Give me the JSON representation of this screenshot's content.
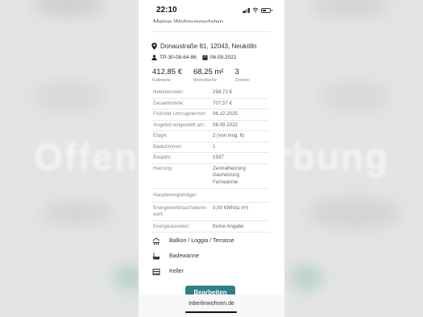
{
  "status_bar": {
    "time": "22:10"
  },
  "listing": {
    "section_title_cut": "Meine Wohnungsdaten",
    "address": "Donaustraße 81, 12043, Neukölln",
    "listing_id": "TP-30-08-64-86",
    "date": "06.09.2022",
    "kpis": [
      {
        "value": "412,85 €",
        "label": "Kaltmiete"
      },
      {
        "value": "68,25 m²",
        "label": "Wohnfläche"
      },
      {
        "value": "3",
        "label": "Zimmer"
      }
    ],
    "details": [
      {
        "label": "Nebenkosten:",
        "value": "294,72 €"
      },
      {
        "label": "Gesamtmiete:",
        "value": "707,57 €"
      },
      {
        "label": "Frühster Umzugstermin:",
        "value": "06.12.2025"
      },
      {
        "label": "Angebot eingestellt am:",
        "value": "06.09.2022"
      },
      {
        "label": "Etage:",
        "value": "2 (von insg. 6)"
      },
      {
        "label": "Badezimmer:",
        "value": "1"
      },
      {
        "label": "Baujahr:",
        "value": "1937"
      },
      {
        "label": "Heizung:",
        "value": "Zentralheizung\nGasheizung\nFernwärme"
      },
      {
        "label": "Hauptenergieträger:",
        "value": ""
      },
      {
        "label": "Energieverbrauchskenn-\nwert:",
        "value": "0,00 kWh/(a m²)"
      },
      {
        "label": "Energieausweis:",
        "value": "Keine Angabe"
      }
    ],
    "features": [
      {
        "icon": "balcony-icon",
        "label": "Balkon / Loggia / Terrasse"
      },
      {
        "icon": "bathtub-icon",
        "label": "Badewanne"
      },
      {
        "icon": "cellar-icon",
        "label": "Keller"
      }
    ],
    "edit_button": "Bearbeiten"
  },
  "browser": {
    "url": "inberlinwohnen.de"
  },
  "background": {
    "watermark": "Offene Bewerbung"
  }
}
